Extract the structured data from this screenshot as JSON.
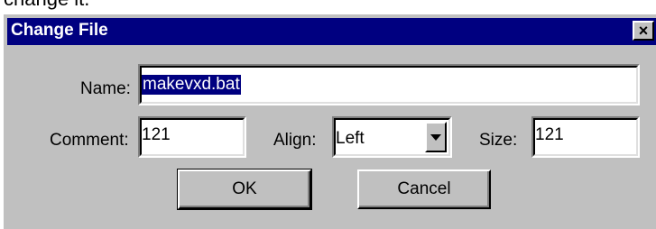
{
  "background_fragment": "change it.",
  "dialog": {
    "title": "Change File",
    "close_glyph": "×"
  },
  "fields": {
    "name": {
      "label": "Name:",
      "value": "makevxd.bat"
    },
    "comment": {
      "label": "Comment:",
      "value": "121"
    },
    "align": {
      "label": "Align:",
      "value": "Left"
    },
    "size": {
      "label": "Size:",
      "value": "121"
    }
  },
  "buttons": {
    "ok": "OK",
    "cancel": "Cancel"
  },
  "colors": {
    "titlebar": "#000080",
    "face": "#c0c0c0",
    "selection": "#000080"
  }
}
